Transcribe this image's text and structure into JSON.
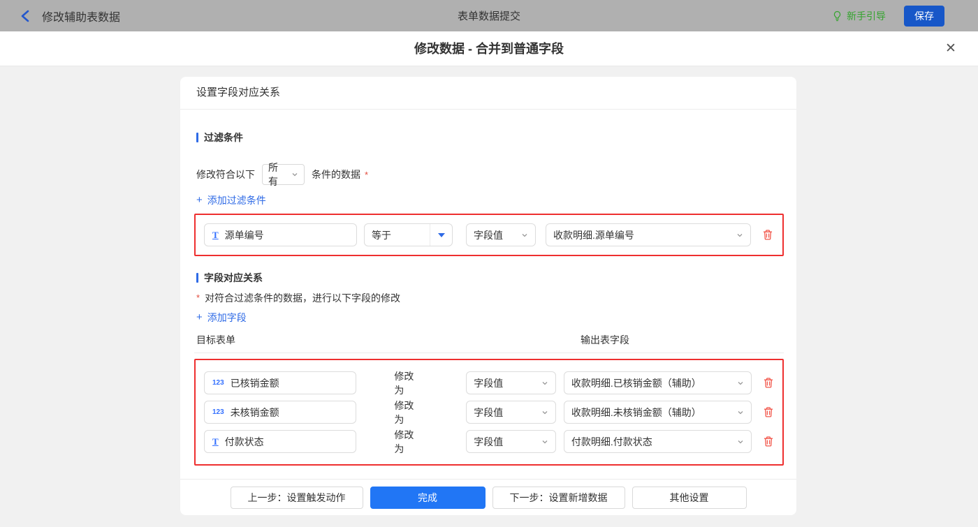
{
  "topbar": {
    "back_label": "修改辅助表数据",
    "title": "表单数据提交",
    "guide_label": "新手引导",
    "save_label": "保存"
  },
  "dialog": {
    "title": "修改数据 - 合并到普通字段",
    "close_glyph": "✕"
  },
  "card": {
    "header": "设置字段对应关系",
    "filter": {
      "title": "过滤条件",
      "prefix_label": "修改符合以下",
      "match_value": "所有",
      "suffix_label": "条件的数据",
      "required_mark": "*",
      "add_plus": "+",
      "add_label": "添加过滤条件",
      "rows": [
        {
          "field_type_glyph": "T",
          "field": "源单编号",
          "operator": "等于",
          "value_type": "字段值",
          "value": "收款明细.源单编号"
        }
      ]
    },
    "mapping": {
      "title": "字段对应关系",
      "required_mark": "*",
      "description": "对符合过滤条件的数据，进行以下字段的修改",
      "add_plus": "+",
      "add_label": "添加字段",
      "col_target": "目标表单",
      "col_output": "输出表字段",
      "modify_label": "修改为",
      "rows": [
        {
          "field_type_glyph": "123",
          "field": "已核销金额",
          "value_type": "字段值",
          "value": "收款明细.已核销金额（辅助）"
        },
        {
          "field_type_glyph": "123",
          "field": "未核销金额",
          "value_type": "字段值",
          "value": "收款明细.未核销金额（辅助）"
        },
        {
          "field_type_glyph": "T",
          "field": "付款状态",
          "value_type": "字段值",
          "value": "付款明细.付款状态"
        }
      ]
    },
    "footer": {
      "prev_label": "上一步：设置触发动作",
      "done_label": "完成",
      "next_label": "下一步：设置新增数据",
      "other_label": "其他设置"
    }
  },
  "colors": {
    "topbar_bg": "#b0b0b0",
    "accent_blue": "#2e6ae6",
    "save_blue": "#1757c8",
    "done_blue": "#2176f5",
    "guide_green": "#35a42e",
    "highlight_red": "#ee2f2f",
    "trash_red": "#f2564a"
  }
}
